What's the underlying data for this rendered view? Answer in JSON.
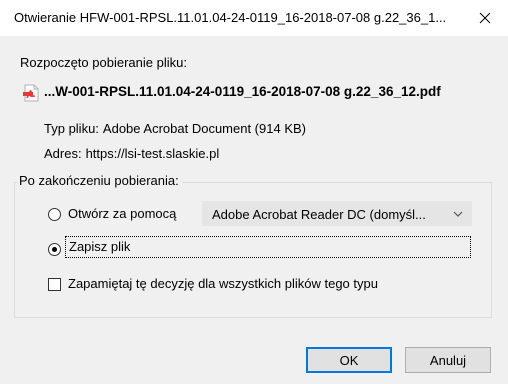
{
  "window": {
    "title": "Otwieranie HFW-001-RPSL.11.01.04-24-0119_16-2018-07-08 g.22_36_1...",
    "close_icon": "close-icon"
  },
  "download": {
    "intro": "Rozpoczęto pobieranie pliku:",
    "file_icon": "pdf-file-icon",
    "filename": "...W-001-RPSL.11.01.04-24-0119_16-2018-07-08 g.22_36_12.pdf",
    "type_label": "Typ pliku:",
    "type_value": "Adobe Acrobat Document (914 KB)",
    "address_label": "Adres:",
    "address_value": "https://lsi-test.slaskie.pl"
  },
  "after_download": {
    "legend": "Po zakończeniu pobierania:",
    "open_with_label": "Otwórz za pomocą",
    "open_with_selected": "Adobe Acrobat Reader DC (domyśl...",
    "open_with_checked": false,
    "save_label": "Zapisz plik",
    "save_checked": true,
    "remember_label": "Zapamiętaj tę decyzję dla wszystkich plików tego typu",
    "remember_checked": false
  },
  "buttons": {
    "ok": "OK",
    "cancel": "Anuluj"
  },
  "colors": {
    "pdf_icon": "#e53935",
    "focus_border": "#0078d7",
    "dialog_bg": "#f0f0f0"
  }
}
